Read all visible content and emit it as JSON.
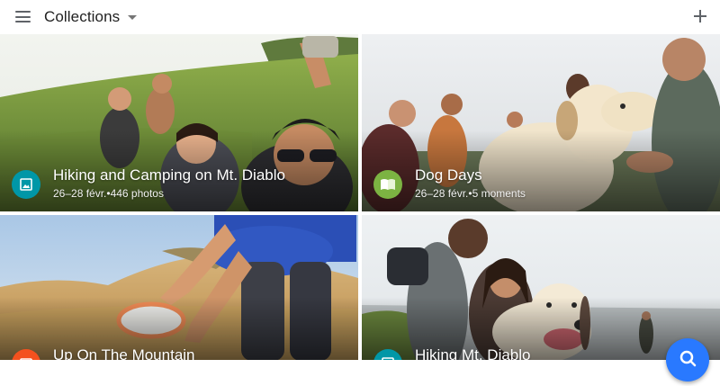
{
  "app_bar": {
    "title": "Collections",
    "menu_icon": "hamburger-menu-icon",
    "dropdown_icon": "arrow-drop-down-icon",
    "add_icon": "plus-icon"
  },
  "collections": [
    {
      "title": "Hiking and Camping on Mt. Diablo",
      "subtitle": "26–28 févr.•446 photos",
      "badge_icon": "photo-album-icon",
      "badge_color": "#0097a7"
    },
    {
      "title": "Dog Days",
      "subtitle": "26–28 févr.•5 moments",
      "badge_icon": "open-book-icon",
      "badge_color": "#7cb342"
    },
    {
      "title": "Up On The Mountain",
      "badge_icon": "collection-icon",
      "badge_color": "#f4511e"
    },
    {
      "title": "Hiking Mt. Diablo",
      "badge_icon": "photo-album-icon",
      "badge_color": "#0097a7"
    }
  ],
  "fab": {
    "icon": "search-icon",
    "color": "#2979ff"
  }
}
